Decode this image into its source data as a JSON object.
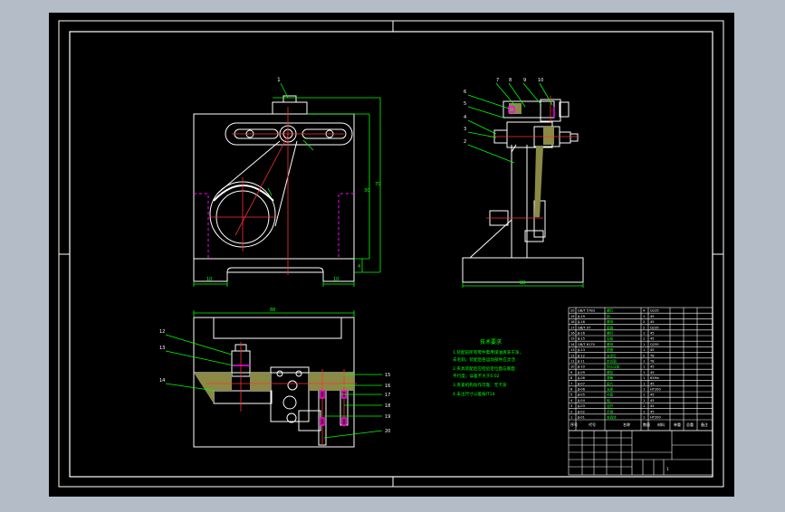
{
  "colors": {
    "window_bg": "#b3bcc7",
    "canvas_bg": "#000000",
    "line_white": "#ffffff",
    "line_green": "#00ff00",
    "line_red": "#ff3030",
    "line_magenta": "#ff00ff",
    "line_yellow": "#ffff00",
    "hatch_olive": "#8a8a46"
  },
  "view_a": {
    "balloon": "1",
    "dims": {
      "v1": "30",
      "v2": "70",
      "h1": "10",
      "h2": "10",
      "v3": "4"
    }
  },
  "view_b": {
    "top_balloons": [
      "7",
      "8",
      "9",
      "10"
    ],
    "left_balloons": [
      "6",
      "5",
      "4",
      "3",
      "2"
    ],
    "base_dim": "88"
  },
  "view_c": {
    "top_dim": "88",
    "left_balloons": [
      "12",
      "13",
      "14"
    ],
    "right_balloons": [
      "15",
      "16",
      "17",
      "18",
      "19",
      "20"
    ]
  },
  "notes": {
    "title": "技术要求",
    "lines": [
      "1.装配前所有零件需用煤油清洗干净，",
      "去毛刺，装配后各运动部件应灵活",
      "2.夹具装配后应检验定位面与底面",
      "平行度，误差不大于0.02",
      "3.夹紧机构动作可靠、无卡滞",
      "4.未注尺寸公差按IT14"
    ]
  },
  "bom": {
    "rows": [
      [
        "20",
        "GB/T 5783",
        "螺钉",
        "4",
        "Q235"
      ],
      [
        "19",
        "JJ-19",
        "销",
        "1",
        "45"
      ],
      [
        "18",
        "JJ-18",
        "螺母",
        "2",
        "45"
      ],
      [
        "17",
        "GB/T 97",
        "垫圈",
        "2",
        "Q235"
      ],
      [
        "16",
        "JJ-16",
        "螺杆",
        "1",
        "45"
      ],
      [
        "15",
        "JJ-15",
        "压板",
        "1",
        "45"
      ],
      [
        "14",
        "GB/T 6170",
        "螺母",
        "1",
        "Q235"
      ],
      [
        "13",
        "JJ-13",
        "垫圈",
        "1",
        "45"
      ],
      [
        "12",
        "JJ-12",
        "支承钉",
        "2",
        "T8"
      ],
      [
        "11",
        "JJ-11",
        "定位销",
        "1",
        "T8"
      ],
      [
        "10",
        "JJ-10",
        "钩头压板",
        "1",
        "45"
      ],
      [
        "9",
        "JJ-09",
        "螺栓",
        "1",
        "45"
      ],
      [
        "8",
        "JJ-08",
        "弹簧",
        "1",
        "65Mn"
      ],
      [
        "7",
        "JJ-07",
        "垫片",
        "1",
        "45"
      ],
      [
        "6",
        "JJ-06",
        "支座",
        "1",
        "HT200"
      ],
      [
        "5",
        "JJ-05",
        "衬套",
        "1",
        "45"
      ],
      [
        "4",
        "JJ-04",
        "轴",
        "1",
        "45"
      ],
      [
        "3",
        "JJ-03",
        "连杆",
        "1",
        "45"
      ],
      [
        "2",
        "JJ-02",
        "手柄",
        "1",
        "45"
      ],
      [
        "1",
        "JJ-01",
        "夹具体",
        "1",
        "HT200"
      ]
    ],
    "header": [
      "序号",
      "代号",
      "名称",
      "数量",
      "材料",
      "单重",
      "总重",
      "备注"
    ]
  },
  "title_block": {
    "sheet_label": "1"
  }
}
